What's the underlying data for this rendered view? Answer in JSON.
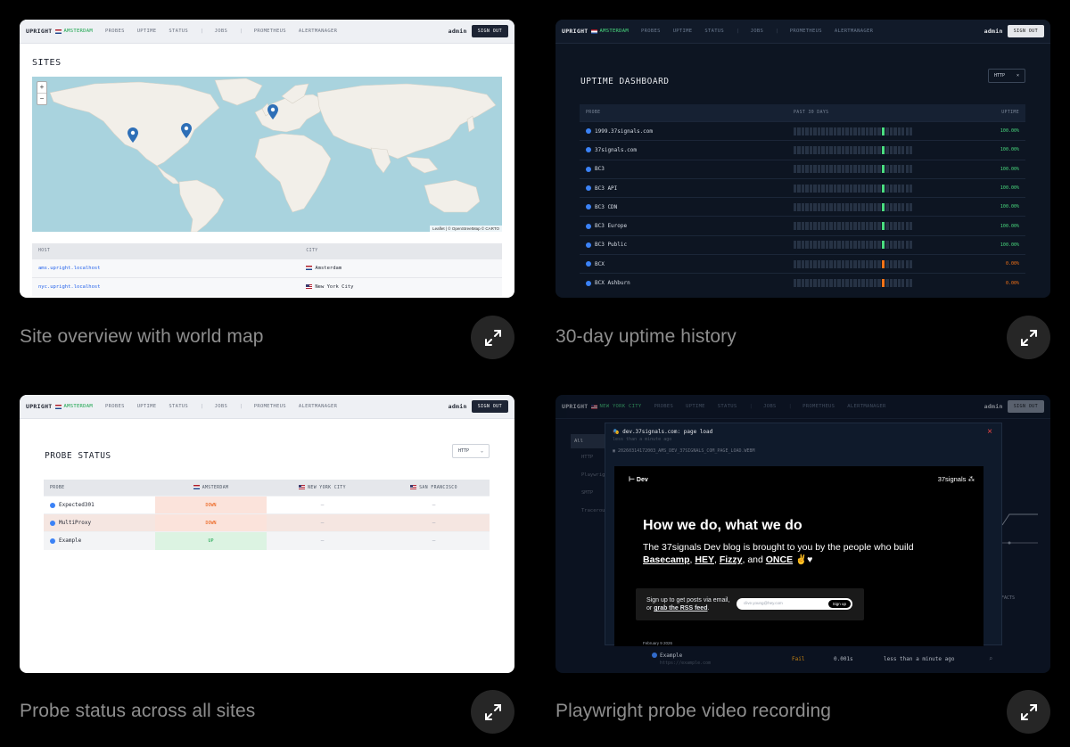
{
  "cards": [
    {
      "caption": "Site overview with world map",
      "nav": {
        "brand": "UPRIGHT",
        "site": "AMSTERDAM",
        "links": [
          "PROBES",
          "UPTIME",
          "STATUS",
          "JOBS",
          "PROMETHEUS",
          "ALERTMANAGER"
        ],
        "user": "admin",
        "signout": "SIGN OUT"
      },
      "heading": "SITES",
      "map_attribution": "Leaflet | © OpenStreetMap © CARTO",
      "zoom_in": "+",
      "zoom_out": "−",
      "table_headers": [
        "HOST",
        "CITY"
      ],
      "rows": [
        {
          "host": "ams.upright.localhost",
          "city": "Amsterdam"
        },
        {
          "host": "nyc.upright.localhost",
          "city": "New York City"
        }
      ]
    },
    {
      "caption": "30-day uptime history",
      "nav": {
        "brand": "UPRIGHT",
        "site": "AMSTERDAM",
        "links": [
          "PROBES",
          "UPTIME",
          "STATUS",
          "JOBS",
          "PROMETHEUS",
          "ALERTMANAGER"
        ],
        "user": "admin",
        "signout": "SIGN OUT"
      },
      "heading": "UPTIME DASHBOARD",
      "filter": "HTTP",
      "table_headers": [
        "PROBE",
        "PAST 30 DAYS",
        "UPTIME"
      ],
      "rows": [
        {
          "probe": "1999.37signals.com",
          "uptime": "100.00%",
          "status": "ok"
        },
        {
          "probe": "37signals.com",
          "uptime": "100.00%",
          "status": "ok"
        },
        {
          "probe": "BC3",
          "uptime": "100.00%",
          "status": "ok"
        },
        {
          "probe": "BC3 API",
          "uptime": "100.00%",
          "status": "ok"
        },
        {
          "probe": "BC3 CDN",
          "uptime": "100.00%",
          "status": "ok"
        },
        {
          "probe": "BC3 Europe",
          "uptime": "100.00%",
          "status": "ok"
        },
        {
          "probe": "BC3 Public",
          "uptime": "100.00%",
          "status": "ok"
        },
        {
          "probe": "BCX",
          "uptime": "0.00%",
          "status": "bad"
        },
        {
          "probe": "BCX Ashburn",
          "uptime": "0.00%",
          "status": "bad"
        }
      ]
    },
    {
      "caption": "Probe status across all sites",
      "nav": {
        "brand": "UPRIGHT",
        "site": "AMSTERDAM",
        "links": [
          "PROBES",
          "UPTIME",
          "STATUS",
          "JOBS",
          "PROMETHEUS",
          "ALERTMANAGER"
        ],
        "user": "admin",
        "signout": "SIGN OUT"
      },
      "heading": "PROBE STATUS",
      "filter": "HTTP",
      "table_headers": [
        "PROBE",
        "AMSTERDAM",
        "NEW YORK CITY",
        "SAN FRANCISCO"
      ],
      "rows": [
        {
          "probe": "Expected301",
          "ams": "DOWN",
          "nyc": "—",
          "sf": "—"
        },
        {
          "probe": "MultiProxy",
          "ams": "DOWN",
          "nyc": "—",
          "sf": "—"
        },
        {
          "probe": "Example",
          "ams": "UP",
          "nyc": "—",
          "sf": "—"
        }
      ]
    },
    {
      "caption": "Playwright probe video recording",
      "nav": {
        "brand": "UPRIGHT",
        "site": "NEW YORK CITY",
        "links": [
          "PROBES",
          "UPTIME",
          "STATUS",
          "JOBS",
          "PROMETHEUS",
          "ALERTMANAGER"
        ],
        "user": "admin",
        "signout": "SIGN OUT"
      },
      "sidebar": [
        "All",
        "HTTP",
        "Playwright",
        "SMTP",
        "Traceroute"
      ],
      "modal": {
        "title": "dev.37signals.com: page load",
        "subtitle": "less than a minute ago",
        "file": "20260314172003_AMS_DEV_37SIGNALS_COM_PAGE_LOAD.WEBM",
        "close": "×"
      },
      "video": {
        "nav_left": "Dev",
        "nav_right": "37signals",
        "headline": "How we do, what we do",
        "body": "The 37signals Dev blog is brought to you by the people who build",
        "links": [
          "Basecamp",
          "HEY",
          "Fizzy",
          "ONCE"
        ],
        "signup_line1": "Sign up to get posts via email,",
        "signup_line2": "or",
        "rss": "grab the RSS feed",
        "email_placeholder": "clive.young@hey.com",
        "signup_button": "Sign up",
        "date": "February 9 2026"
      },
      "bg_row": {
        "name": "Example",
        "url": "https://example.com",
        "status": "Fail",
        "duration": "0.001s",
        "time": "less than a minute ago"
      },
      "bg_header": "FACTS"
    }
  ],
  "colors": {
    "green": "#4ade80",
    "orange": "#f97316",
    "blue": "#2563eb",
    "navy": "#1d2434"
  }
}
